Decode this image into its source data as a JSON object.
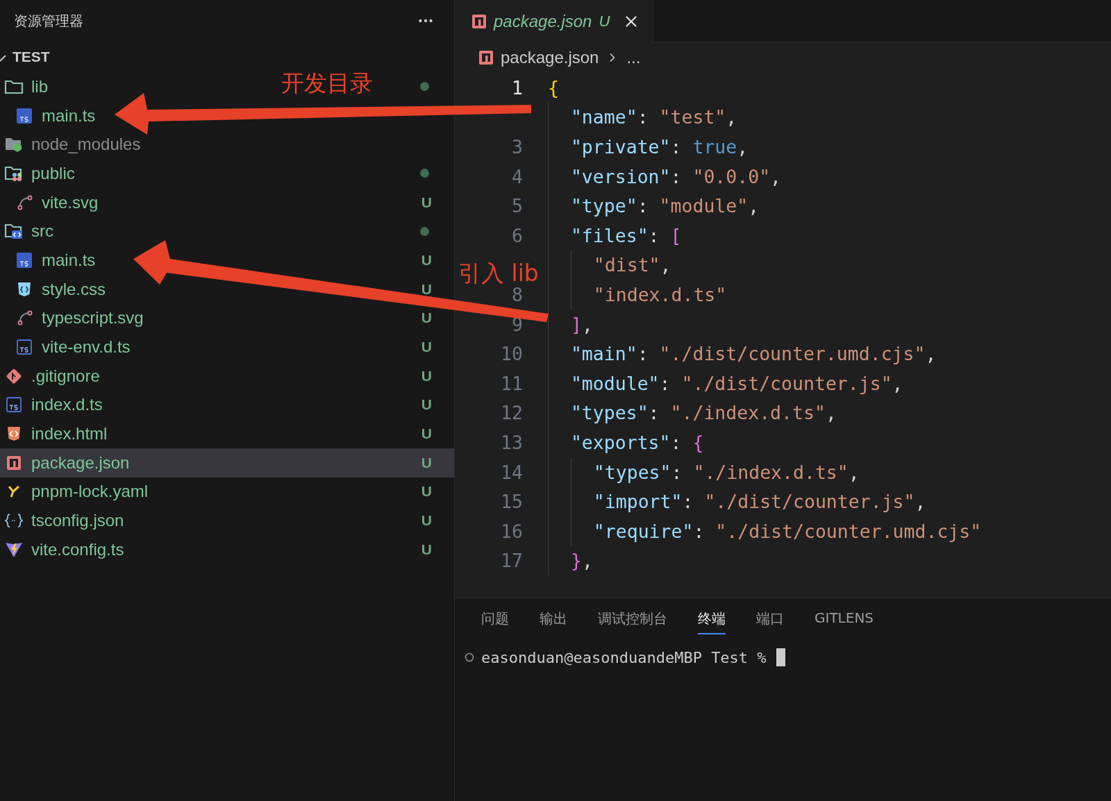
{
  "sidebar": {
    "title": "资源管理器",
    "root": {
      "label": "TEST",
      "expanded": true
    },
    "tree": [
      {
        "name": "lib",
        "kind": "folder",
        "dot": true,
        "ignored": false,
        "selected": false,
        "children": [
          {
            "name": "main.ts",
            "kind": "ts",
            "ignored": false,
            "selected": false
          }
        ]
      },
      {
        "name": "node_modules",
        "kind": "node-folder",
        "ignored": true,
        "selected": false
      },
      {
        "name": "public",
        "kind": "public-folder",
        "dot": true,
        "ignored": false,
        "selected": false,
        "children": [
          {
            "name": "vite.svg",
            "kind": "svg",
            "status": "U",
            "ignored": false,
            "selected": false
          }
        ]
      },
      {
        "name": "src",
        "kind": "src-folder",
        "dot": true,
        "ignored": false,
        "selected": false,
        "children": [
          {
            "name": "main.ts",
            "kind": "ts",
            "status": "U",
            "ignored": false,
            "selected": false
          },
          {
            "name": "style.css",
            "kind": "css",
            "status": "U",
            "ignored": false,
            "selected": false
          },
          {
            "name": "typescript.svg",
            "kind": "svg",
            "status": "U",
            "ignored": false,
            "selected": false
          },
          {
            "name": "vite-env.d.ts",
            "kind": "dts",
            "status": "U",
            "ignored": false,
            "selected": false
          }
        ]
      },
      {
        "name": ".gitignore",
        "kind": "git",
        "status": "U",
        "ignored": false,
        "selected": false
      },
      {
        "name": "index.d.ts",
        "kind": "dts",
        "status": "U",
        "ignored": false,
        "selected": false
      },
      {
        "name": "index.html",
        "kind": "html",
        "status": "U",
        "ignored": false,
        "selected": false
      },
      {
        "name": "package.json",
        "kind": "npm",
        "status": "U",
        "ignored": false,
        "selected": true
      },
      {
        "name": "pnpm-lock.yaml",
        "kind": "yaml",
        "status": "U",
        "ignored": false,
        "selected": false
      },
      {
        "name": "tsconfig.json",
        "kind": "json",
        "status": "U",
        "ignored": false,
        "selected": false
      },
      {
        "name": "vite.config.ts",
        "kind": "vite",
        "status": "U",
        "ignored": false,
        "selected": false
      }
    ]
  },
  "editor": {
    "tabs": [
      {
        "label": "package.json",
        "status": "U",
        "selected": true
      }
    ],
    "breadcrumb": [
      "package.json",
      "..."
    ],
    "lines": [
      {
        "number": "1",
        "current": true,
        "tokens": [
          {
            "text": "{",
            "kind": "brace"
          }
        ]
      },
      {
        "tokens": [
          {
            "text": "  \"name\"",
            "kind": "key"
          },
          {
            "text": ": ",
            "kind": "punct"
          },
          {
            "text": "\"test\"",
            "kind": "string"
          },
          {
            "text": ",",
            "kind": "punct"
          }
        ]
      },
      {
        "number": "3",
        "current": false,
        "tokens": [
          {
            "text": "  \"private\"",
            "kind": "key"
          },
          {
            "text": ": ",
            "kind": "punct"
          },
          {
            "text": "true",
            "kind": "keyword"
          },
          {
            "text": ",",
            "kind": "punct"
          }
        ]
      },
      {
        "number": "4",
        "current": false,
        "tokens": [
          {
            "text": "  \"version\"",
            "kind": "key"
          },
          {
            "text": ": ",
            "kind": "punct"
          },
          {
            "text": "\"0.0.0\"",
            "kind": "string"
          },
          {
            "text": ",",
            "kind": "punct"
          }
        ]
      },
      {
        "number": "5",
        "current": false,
        "tokens": [
          {
            "text": "  \"type\"",
            "kind": "key"
          },
          {
            "text": ": ",
            "kind": "punct"
          },
          {
            "text": "\"module\"",
            "kind": "string"
          },
          {
            "text": ",",
            "kind": "punct"
          }
        ]
      },
      {
        "number": "6",
        "current": false,
        "tokens": [
          {
            "text": "  \"files\"",
            "kind": "key"
          },
          {
            "text": ": ",
            "kind": "punct"
          },
          {
            "text": "[",
            "kind": "bracket"
          }
        ]
      },
      {
        "tokens": [
          {
            "text": "    \"dist\"",
            "kind": "string"
          },
          {
            "text": ",",
            "kind": "punct"
          }
        ]
      },
      {
        "number": "8",
        "current": false,
        "tokens": [
          {
            "text": "    \"index.d.ts\"",
            "kind": "string"
          }
        ]
      },
      {
        "number": "9",
        "current": false,
        "tokens": [
          {
            "text": "  ]",
            "kind": "bracket"
          },
          {
            "text": ",",
            "kind": "punct"
          }
        ]
      },
      {
        "number": "10",
        "current": false,
        "tokens": [
          {
            "text": "  \"main\"",
            "kind": "key"
          },
          {
            "text": ": ",
            "kind": "punct"
          },
          {
            "text": "\"./dist/counter.umd.cjs\"",
            "kind": "string"
          },
          {
            "text": ",",
            "kind": "punct"
          }
        ]
      },
      {
        "number": "11",
        "current": false,
        "tokens": [
          {
            "text": "  \"module\"",
            "kind": "key"
          },
          {
            "text": ": ",
            "kind": "punct"
          },
          {
            "text": "\"./dist/counter.js\"",
            "kind": "string"
          },
          {
            "text": ",",
            "kind": "punct"
          }
        ]
      },
      {
        "number": "12",
        "current": false,
        "tokens": [
          {
            "text": "  \"types\"",
            "kind": "key"
          },
          {
            "text": ": ",
            "kind": "punct"
          },
          {
            "text": "\"./index.d.ts\"",
            "kind": "string"
          },
          {
            "text": ",",
            "kind": "punct"
          }
        ]
      },
      {
        "number": "13",
        "current": false,
        "tokens": [
          {
            "text": "  \"exports\"",
            "kind": "key"
          },
          {
            "text": ": ",
            "kind": "punct"
          },
          {
            "text": "{",
            "kind": "bracket"
          }
        ]
      },
      {
        "number": "14",
        "current": false,
        "tokens": [
          {
            "text": "    \"types\"",
            "kind": "key"
          },
          {
            "text": ": ",
            "kind": "punct"
          },
          {
            "text": "\"./index.d.ts\"",
            "kind": "string"
          },
          {
            "text": ",",
            "kind": "punct"
          }
        ]
      },
      {
        "number": "15",
        "current": false,
        "tokens": [
          {
            "text": "    \"import\"",
            "kind": "key"
          },
          {
            "text": ": ",
            "kind": "punct"
          },
          {
            "text": "\"./dist/counter.js\"",
            "kind": "string"
          },
          {
            "text": ",",
            "kind": "punct"
          }
        ]
      },
      {
        "number": "16",
        "current": false,
        "tokens": [
          {
            "text": "    \"require\"",
            "kind": "key"
          },
          {
            "text": ": ",
            "kind": "punct"
          },
          {
            "text": "\"./dist/counter.umd.cjs\"",
            "kind": "string"
          }
        ]
      },
      {
        "number": "17",
        "current": false,
        "tokens": [
          {
            "text": "  }",
            "kind": "bracket"
          },
          {
            "text": ",",
            "kind": "punct"
          }
        ]
      }
    ]
  },
  "panel": {
    "tabs": [
      {
        "label": "问题",
        "selected": false
      },
      {
        "label": "输出",
        "selected": false
      },
      {
        "label": "调试控制台",
        "selected": false
      },
      {
        "label": "终端",
        "selected": true
      },
      {
        "label": "端口",
        "selected": false
      },
      {
        "label": "GITLENS",
        "selected": false
      }
    ],
    "terminal": {
      "prompt": "easonduan@easonduandeMBP Test %"
    }
  },
  "annotations": [
    {
      "label": "开发目录"
    },
    {
      "label": "引入 lib"
    }
  ]
}
